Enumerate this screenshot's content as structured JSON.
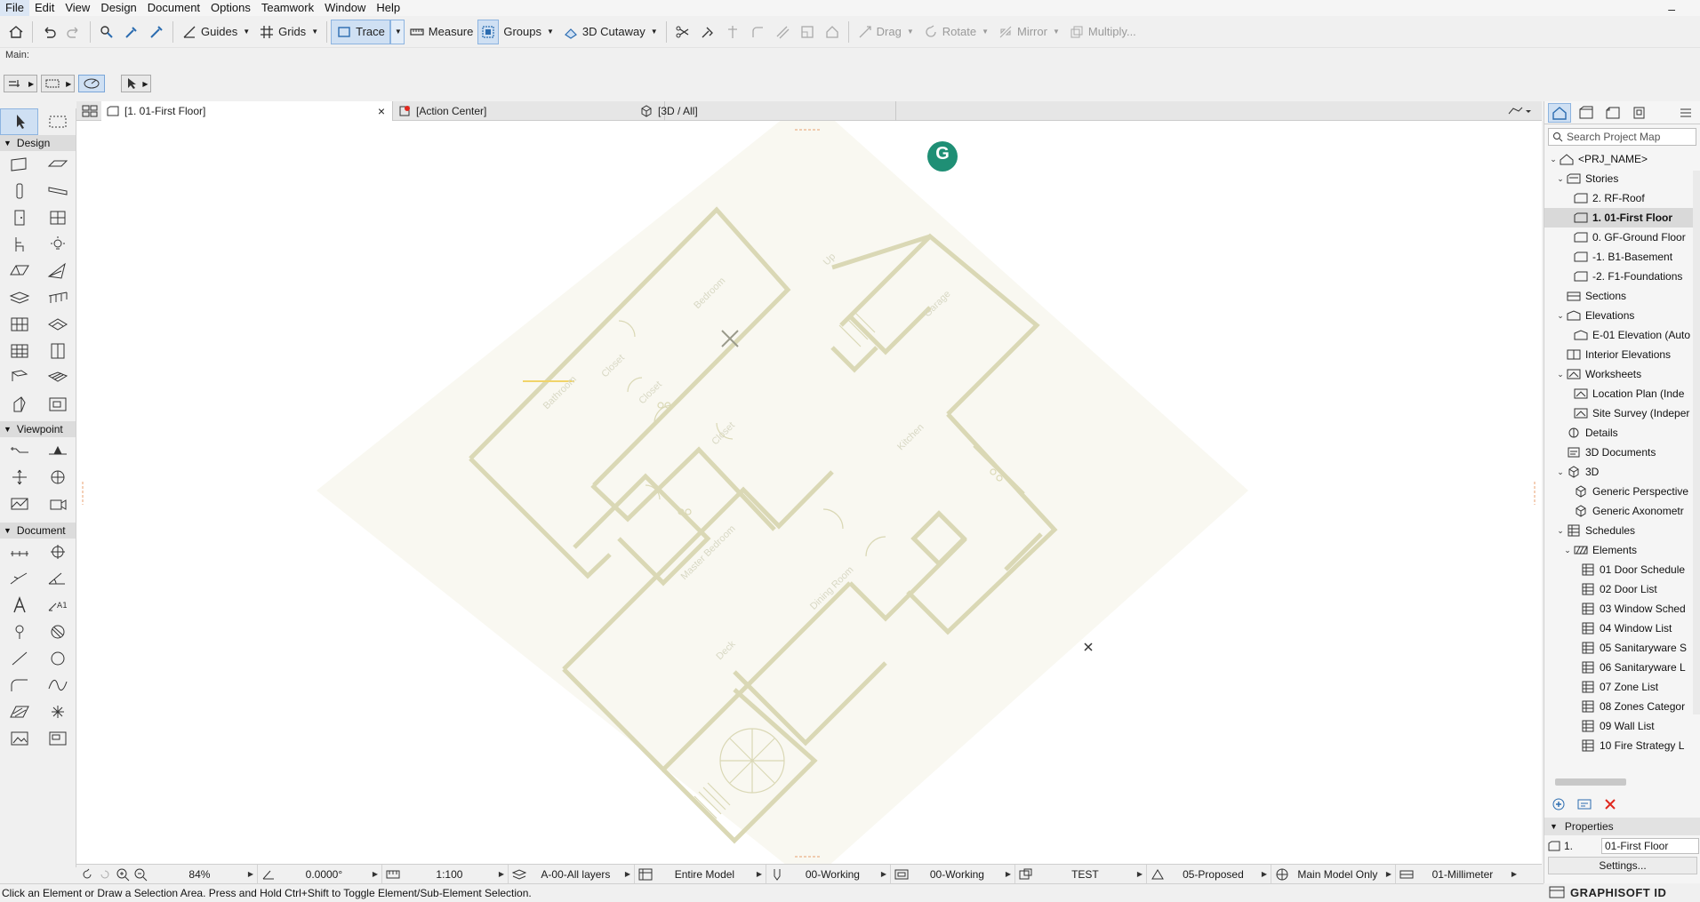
{
  "menubar": {
    "items": [
      "File",
      "Edit",
      "View",
      "Design",
      "Document",
      "Options",
      "Teamwork",
      "Window",
      "Help"
    ],
    "minimize": "–"
  },
  "toolbar": {
    "guides": "Guides",
    "grids": "Grids",
    "trace": "Trace",
    "measure": "Measure",
    "groups": "Groups",
    "cutaway": "3D Cutaway",
    "drag": "Drag",
    "rotate": "Rotate",
    "mirror": "Mirror",
    "multiply": "Multiply..."
  },
  "main_label": "Main:",
  "toolbox": {
    "design_header": "Design",
    "viewpoint_header": "Viewpoint",
    "document_header": "Document"
  },
  "tabs": [
    {
      "label": "[1. 01-First Floor]",
      "close": "×"
    },
    {
      "label": "[Action Center]"
    },
    {
      "label": "[3D / All]"
    }
  ],
  "canvas": {
    "rooms": {
      "bedroom": "Bedroom",
      "garage": "Garage",
      "closet1": "Closet",
      "closet2": "Closet",
      "closet3": "Closet",
      "bathroom": "Bathroom",
      "up": "Up",
      "kitchen": "Kitchen",
      "master_bedroom": "Master Bedroom",
      "dining_room": "Dining Room",
      "deck": "Deck"
    },
    "badge_letter": "G"
  },
  "bottombar": {
    "zoom": "84%",
    "angle": "0.0000°",
    "scale": "1:100",
    "layers": "A-00-All layers",
    "model": "Entire Model",
    "pen1": "00-Working",
    "pen2": "00-Working",
    "custom": "TEST",
    "renovation": "05-Proposed",
    "structure": "Main Model Only",
    "dimension": "01-Millimeter"
  },
  "status": "Click an Element or Draw a Selection Area. Press and Hold Ctrl+Shift to Toggle Element/Sub-Element Selection.",
  "navigator": {
    "search_placeholder": "Search Project Map",
    "tree": [
      {
        "label": "<PRJ_NAME>",
        "level": 0,
        "expand": "v",
        "icon": "project"
      },
      {
        "label": "Stories",
        "level": 1,
        "expand": "v",
        "icon": "stories"
      },
      {
        "label": "2. RF-Roof",
        "level": 2,
        "expand": "",
        "icon": "story"
      },
      {
        "label": "1. 01-First Floor",
        "level": 2,
        "expand": "",
        "icon": "story",
        "selected": true
      },
      {
        "label": "0. GF-Ground Floor",
        "level": 2,
        "expand": "",
        "icon": "story"
      },
      {
        "label": "-1. B1-Basement",
        "level": 2,
        "expand": "",
        "icon": "story"
      },
      {
        "label": "-2. F1-Foundations",
        "level": 2,
        "expand": "",
        "icon": "story"
      },
      {
        "label": "Sections",
        "level": 1,
        "expand": "",
        "icon": "section"
      },
      {
        "label": "Elevations",
        "level": 1,
        "expand": "v",
        "icon": "elevation"
      },
      {
        "label": "E-01 Elevation (Auto",
        "level": 2,
        "expand": "",
        "icon": "elevation"
      },
      {
        "label": "Interior Elevations",
        "level": 1,
        "expand": "",
        "icon": "interior"
      },
      {
        "label": "Worksheets",
        "level": 1,
        "expand": "v",
        "icon": "worksheet"
      },
      {
        "label": "Location Plan (Inde",
        "level": 2,
        "expand": "",
        "icon": "worksheet"
      },
      {
        "label": "Site Survey (Indeper",
        "level": 2,
        "expand": "",
        "icon": "worksheet"
      },
      {
        "label": "Details",
        "level": 1,
        "expand": "",
        "icon": "detail"
      },
      {
        "label": "3D Documents",
        "level": 1,
        "expand": "",
        "icon": "doc3d"
      },
      {
        "label": "3D",
        "level": 1,
        "expand": "v",
        "icon": "cube"
      },
      {
        "label": "Generic Perspective",
        "level": 2,
        "expand": "",
        "icon": "cube"
      },
      {
        "label": "Generic Axonometr",
        "level": 2,
        "expand": "",
        "icon": "cube"
      },
      {
        "label": "Schedules",
        "level": 1,
        "expand": "v",
        "icon": "schedule"
      },
      {
        "label": "Elements",
        "level": 2,
        "expand": "v",
        "icon": "elements"
      },
      {
        "label": "01 Door Schedule",
        "level": 3,
        "expand": "",
        "icon": "schedule"
      },
      {
        "label": "02 Door List",
        "level": 3,
        "expand": "",
        "icon": "schedule"
      },
      {
        "label": "03 Window Sched",
        "level": 3,
        "expand": "",
        "icon": "schedule"
      },
      {
        "label": "04 Window List",
        "level": 3,
        "expand": "",
        "icon": "schedule"
      },
      {
        "label": "05 Sanitaryware S",
        "level": 3,
        "expand": "",
        "icon": "schedule"
      },
      {
        "label": "06 Sanitaryware L",
        "level": 3,
        "expand": "",
        "icon": "schedule"
      },
      {
        "label": "07 Zone List",
        "level": 3,
        "expand": "",
        "icon": "schedule"
      },
      {
        "label": "08 Zones Categor",
        "level": 3,
        "expand": "",
        "icon": "schedule"
      },
      {
        "label": "09 Wall List",
        "level": 3,
        "expand": "",
        "icon": "schedule"
      },
      {
        "label": "10 Fire Strategy L",
        "level": 3,
        "expand": "",
        "icon": "schedule"
      }
    ],
    "properties_header": "Properties",
    "prop_id": "1.",
    "prop_value": "01-First Floor",
    "settings": "Settings..."
  },
  "brand": "GRAPHISOFT ID",
  "colors": {
    "plan_line": "#d9d7b2",
    "plan_fill": "#f9f8f1",
    "accent_blue": "#cfe0f3",
    "badge": "#1f8f75",
    "delete_red": "#e0281e"
  }
}
